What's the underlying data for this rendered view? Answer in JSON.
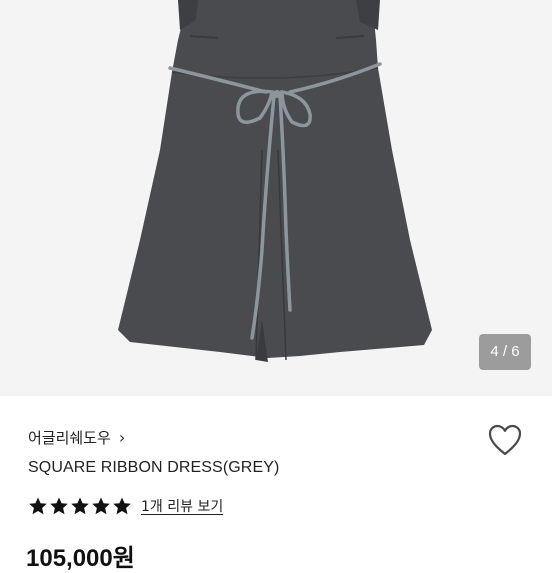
{
  "gallery": {
    "counter": "4 / 6"
  },
  "product": {
    "brand": "어글리쉐도우",
    "brand_chevron": "›",
    "title": "SQUARE RIBBON DRESS(GREY)",
    "rating": 5,
    "rating_max": 5,
    "review_link": "1개 리뷰 보기",
    "price": "105,000원"
  },
  "colors": {
    "dress": "#4a4b4e",
    "ribbon": "#8c969c",
    "background": "#f4f4f4",
    "counter_bg": "#8c8c8c",
    "text": "#222222"
  },
  "icons": {
    "heart": "heart-outline-icon",
    "star": "star-filled-icon"
  }
}
